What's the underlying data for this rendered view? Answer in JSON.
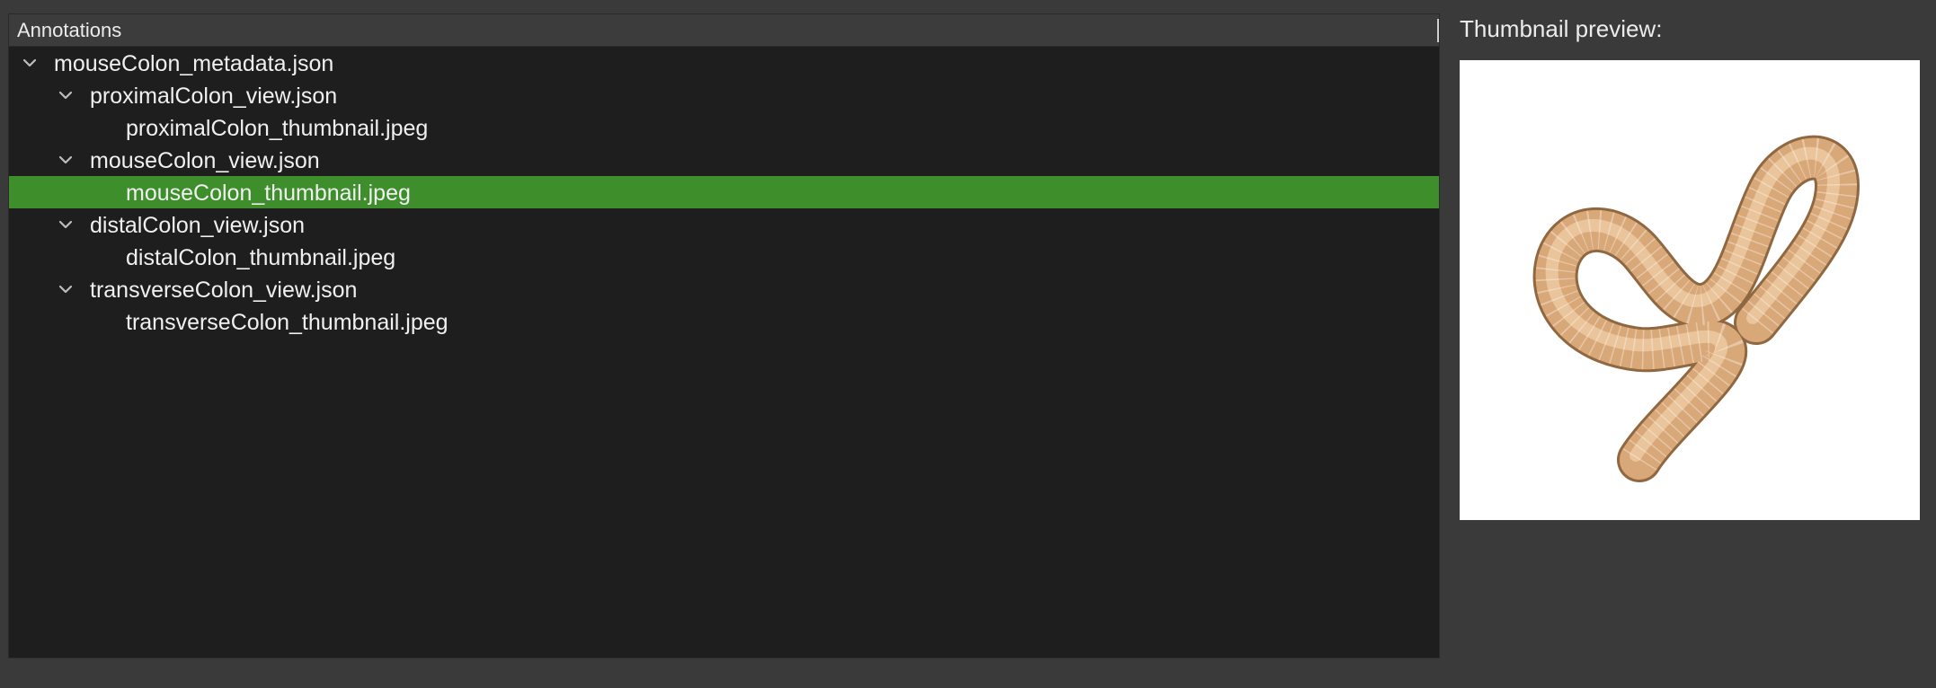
{
  "annotations_panel": {
    "header_label": "Annotations",
    "rows": [
      {
        "label": "mouseColon_metadata.json",
        "level": 0,
        "expanded": true,
        "selected": false
      },
      {
        "label": "proximalColon_view.json",
        "level": 1,
        "expanded": true,
        "selected": false
      },
      {
        "label": "proximalColon_thumbnail.jpeg",
        "level": 2,
        "selected": false
      },
      {
        "label": "mouseColon_view.json",
        "level": 1,
        "expanded": true,
        "selected": false
      },
      {
        "label": "mouseColon_thumbnail.jpeg",
        "level": 2,
        "selected": true
      },
      {
        "label": "distalColon_view.json",
        "level": 1,
        "expanded": true,
        "selected": false
      },
      {
        "label": "distalColon_thumbnail.jpeg",
        "level": 2,
        "selected": false
      },
      {
        "label": "transverseColon_view.json",
        "level": 1,
        "expanded": true,
        "selected": false
      },
      {
        "label": "transverseColon_thumbnail.jpeg",
        "level": 2,
        "selected": false
      }
    ]
  },
  "thumbnail_preview": {
    "title": "Thumbnail preview:"
  },
  "colors": {
    "window_background": "#3a3a3a",
    "panel_background": "#1e1e1e",
    "selection": "#3e8e2c",
    "text": "#f0f0f0",
    "colon_tube": "#d9a878"
  },
  "icons": {
    "expanded_marker": "chevron-down-icon"
  }
}
